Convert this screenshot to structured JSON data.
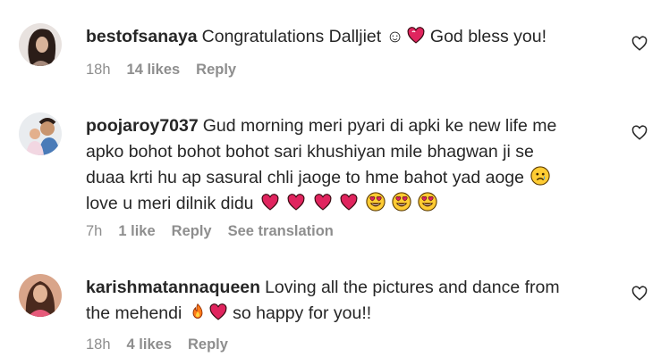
{
  "comments": [
    {
      "username": "bestofsanaya",
      "text_before": "Congratulations Dalljiet ☺",
      "text_after": " God bless you!",
      "time": "18h",
      "likes": "14 likes",
      "reply": "Reply"
    },
    {
      "username": "poojaroy7037",
      "line1": "Gud morning meri pyari di apki ke new life me",
      "line2": "apko bohot bohot bohot sari khushiyan mile bhagwan ji se",
      "line3": "duaa krti hu ap sasural chli jaoge to hme bahot yad aoge",
      "line4": "love u meri dilnik didu",
      "time": "7h",
      "likes": "1 like",
      "reply": "Reply",
      "translate": "See translation"
    },
    {
      "username": "karishmatannaqueen",
      "line1": "Loving all the pictures and dance from",
      "line2_before": "the mehendi",
      "line2_after": " so happy for you!!",
      "time": "18h",
      "likes": "4 likes",
      "reply": "Reply"
    }
  ],
  "icons": [
    "heart-outline-icon",
    "sparkling-heart-emoji",
    "red-heart-emoji",
    "heart-eyes-emoji",
    "sad-face-emoji",
    "fire-emoji"
  ],
  "colors": {
    "text": "#262626",
    "meta": "#8e8e8e",
    "heart": "#e0245e"
  }
}
